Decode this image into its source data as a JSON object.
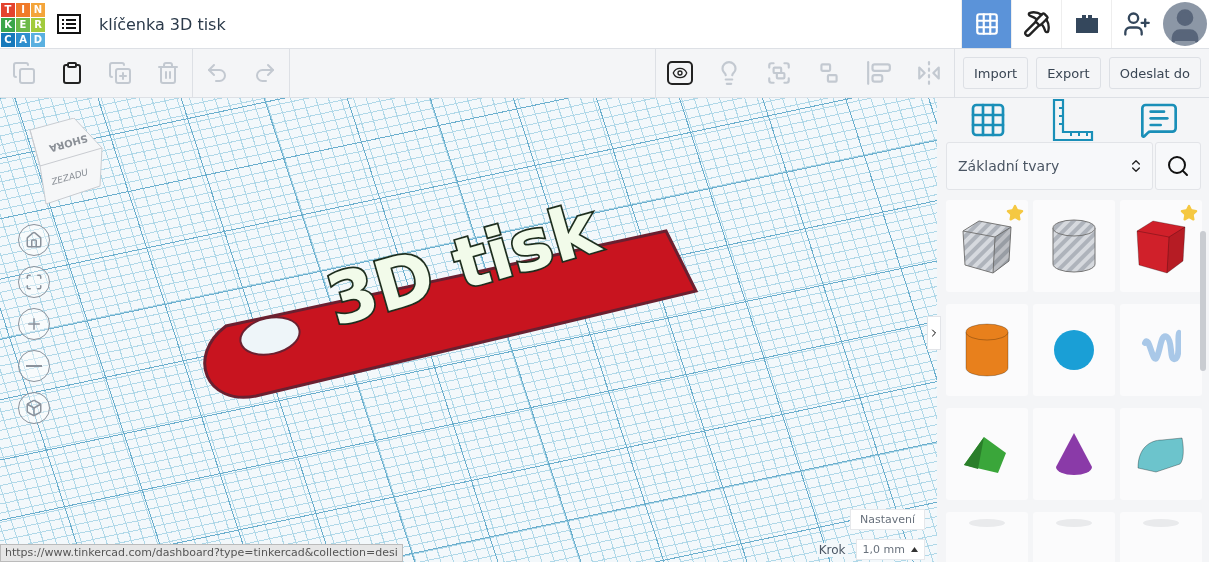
{
  "header": {
    "logo": [
      {
        "letter": "T",
        "color": "#e4432e"
      },
      {
        "letter": "I",
        "color": "#f07a2a"
      },
      {
        "letter": "N",
        "color": "#f4a53a"
      },
      {
        "letter": "K",
        "color": "#3aa54a"
      },
      {
        "letter": "E",
        "color": "#6cb94a"
      },
      {
        "letter": "R",
        "color": "#a2cb3c"
      },
      {
        "letter": "C",
        "color": "#1679bb"
      },
      {
        "letter": "A",
        "color": "#2e8fce"
      },
      {
        "letter": "D",
        "color": "#5ab0e0"
      }
    ],
    "title": "klíčenka 3D tisk",
    "views": [
      {
        "kind": "grid",
        "selected": true
      },
      {
        "kind": "pickaxe",
        "selected": false
      },
      {
        "kind": "brick",
        "selected": false
      }
    ]
  },
  "toolbar": {
    "edit_tools": [
      {
        "kind": "copy",
        "disabled": true
      },
      {
        "kind": "paste",
        "disabled": false
      },
      {
        "kind": "duplicate",
        "disabled": true
      },
      {
        "kind": "delete",
        "disabled": true
      },
      {
        "kind": "undo",
        "disabled": true
      },
      {
        "kind": "redo",
        "disabled": true
      }
    ],
    "view_tools": [
      {
        "kind": "notes",
        "disabled": false
      },
      {
        "kind": "bulb",
        "disabled": true
      },
      {
        "kind": "group",
        "disabled": true
      },
      {
        "kind": "ungroup",
        "disabled": true
      },
      {
        "kind": "align",
        "disabled": true
      },
      {
        "kind": "mirror",
        "disabled": true
      }
    ],
    "actions": [
      "Import",
      "Export",
      "Odeslat do"
    ]
  },
  "scene": {
    "view_cube": {
      "top": "SHORA",
      "back": "ZEZADU"
    },
    "nav": [
      {
        "kind": "home"
      },
      {
        "kind": "fit"
      },
      {
        "kind": "zoom-in"
      },
      {
        "kind": "zoom-out"
      },
      {
        "kind": "perspective"
      }
    ],
    "model_text": "3D tisk",
    "settings_button": "Nastavení",
    "snap": {
      "label": "Krok",
      "value": "1,0 mm"
    },
    "status_url": "https://www.tinkercad.com/dashboard?type=tinkercad&collection=desi"
  },
  "sidebar": {
    "category": "Základní tvary",
    "shapes": [
      {
        "kind": "box-hole",
        "starred": true
      },
      {
        "kind": "cylinder-hole",
        "starred": false
      },
      {
        "kind": "box",
        "color": "#d0202a",
        "starred": true
      },
      {
        "kind": "cylinder",
        "color": "#e8801c",
        "starred": false
      },
      {
        "kind": "sphere",
        "color": "#1a9fd6",
        "starred": false
      },
      {
        "kind": "scribble",
        "color": "#a9c8e8",
        "starred": false
      },
      {
        "kind": "roof",
        "color": "#3aa63a",
        "starred": false
      },
      {
        "kind": "cone",
        "color": "#8a3aa8",
        "starred": false
      },
      {
        "kind": "round-roof",
        "color": "#6cc4cc",
        "starred": false
      },
      {
        "kind": "partial",
        "starred": false
      },
      {
        "kind": "partial",
        "starred": false
      },
      {
        "kind": "partial",
        "starred": false
      }
    ]
  }
}
